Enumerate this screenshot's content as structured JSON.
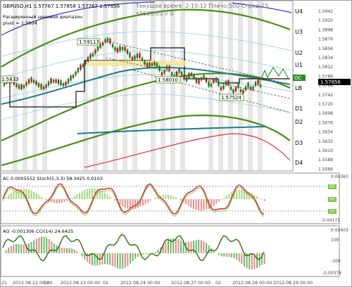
{
  "window": {
    "title": "GBPUSD,H1",
    "ohlc": "1.57767 1.57858 1.57767 1.57856",
    "ind_title": "Расширенный ценовой диапазон",
    "pivot_label": "pivot = 1.5804",
    "header_time": "Текущее время: 2:10:12 Плечо:500 Спрэд:15",
    "header_balance": "$9618.03",
    "header_slash": "// 0"
  },
  "levels": {
    "u4": "U4",
    "u3": "U3",
    "u2": "U2",
    "u1": "U1",
    "oc": "OC",
    "lb": "LB",
    "d1": "D1",
    "d2": "D2",
    "d3": "D3",
    "d4": "D4"
  },
  "price_axis": [
    "1.5942",
    "1.5920",
    "1.5898",
    "1.5876",
    "1.5856",
    "1.5834",
    "1.5812",
    "1.5786",
    "1.5764",
    "1.5742",
    "1.5720",
    "1.5698",
    "1.5676",
    "1.5654",
    "1.5632",
    "1.5610",
    "1.5588",
    "1.5566"
  ],
  "price_labels": {
    "p1": "1.59113",
    "p2": "1.58010",
    "p3": "1.57524",
    "p4": "1.5833",
    "last": "1.57856"
  },
  "ac_panel": {
    "title": "AC 0.0005552",
    "stoch": "Stoch(5,3,3) 58.3425 0.0103",
    "scale": [
      "0.00263",
      "80",
      "50",
      "20",
      "-0.00171"
    ]
  },
  "ao_panel": {
    "title": "AO -0.001306",
    "cci": "CCI(14) 24.6425",
    "scale": [
      "0.00403",
      "100",
      "-100",
      "-0.00376"
    ]
  },
  "time_axis": [
    "21",
    "2012.08.22 00:00",
    "02",
    "2012.08.23 00:00",
    "02",
    "2012.08.24 00:00",
    "2012.08.27 00:00",
    "02",
    "2012.08.28 00:00",
    "2012.08.29 00:00"
  ],
  "colors": {
    "bull": "#1a7a1a",
    "bear": "#cc1111",
    "green": "#3d8c14",
    "teal": "#1f7a8a",
    "red": "#d9363e"
  }
}
